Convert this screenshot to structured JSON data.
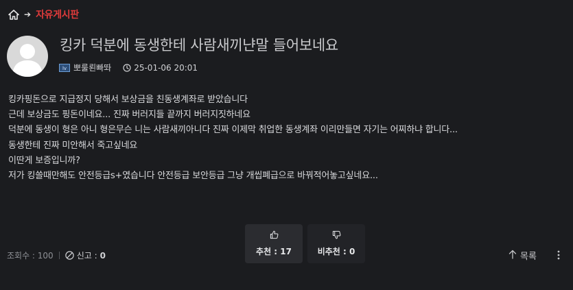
{
  "breadcrumb": {
    "home_icon": "home-icon",
    "arrow_icon": "arrow-right-icon",
    "board_name": "자유게시판"
  },
  "colors": {
    "accent": "#e03b3b",
    "background": "#1b1c1f",
    "button_bg": "#2b2c30"
  },
  "post": {
    "title": "킹카 덕분에 동생한테 사람새끼냔말 들어보네요",
    "author": "뽀룰뢴빠똬",
    "level_badge": "lv",
    "timestamp": "25-01-06 20:01",
    "body": [
      "킹카핑돈으로 지급정지 당해서 보상금을 친동생계좌로 받았습니다",
      "근데 보상금도 핑돈이네요... 진짜 버러지들 끝까지 버러지짓하네요",
      "덕분에 동생이 형은 아니 형은무슨 니는 사람새끼아니다 진짜 이제막 취업한 동생계좌 이리만들면 자기는 어찌하냐 합니다...",
      "동생한테 진짜 미안해서 죽고싶네요",
      "이딴게 보증입니까?",
      "저가 킹쓸때만해도 안전등급s+였습니다 안전등급 보안등급 그냥 개씹폐급으로 바꿔적어놓고싶네요..."
    ]
  },
  "stats": {
    "views_label": "조회수 : 100",
    "report_label": "신고 :",
    "report_count": "0"
  },
  "vote": {
    "up_label": "추천 : 17",
    "down_label": "비추천 : 0"
  },
  "nav": {
    "list_label": "목록"
  }
}
